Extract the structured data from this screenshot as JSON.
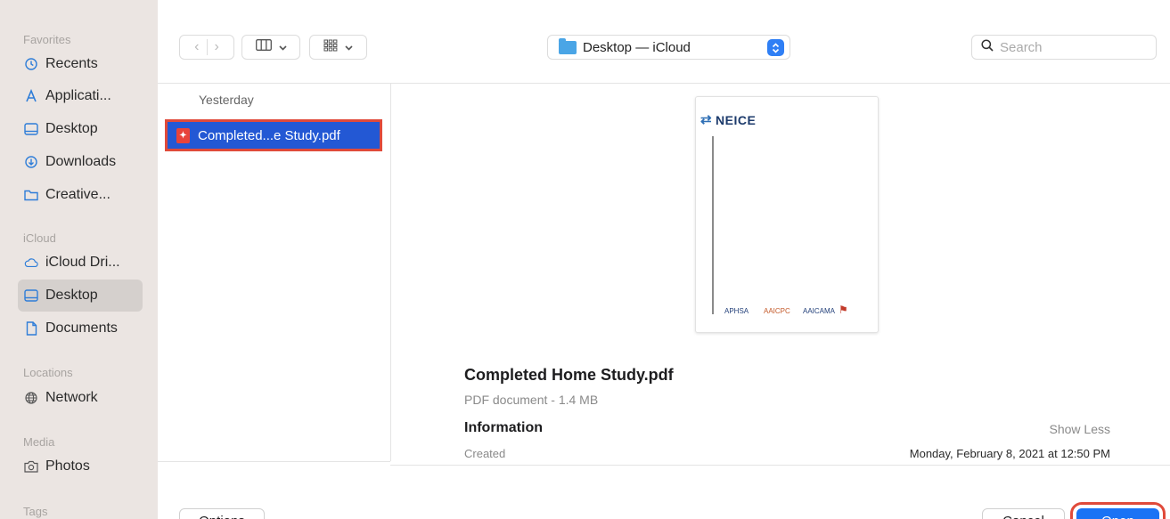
{
  "sidebar": {
    "favorites_label": "Favorites",
    "icloud_label": "iCloud",
    "locations_label": "Locations",
    "media_label": "Media",
    "tags_label": "Tags",
    "favorites": [
      {
        "label": "Recents",
        "icon": "clock-icon"
      },
      {
        "label": "Applicati...",
        "icon": "applications-icon"
      },
      {
        "label": "Desktop",
        "icon": "desktop-icon"
      },
      {
        "label": "Downloads",
        "icon": "downloads-icon"
      },
      {
        "label": "Creative...",
        "icon": "folder-icon"
      }
    ],
    "icloud": [
      {
        "label": "iCloud Dri...",
        "icon": "cloud-icon"
      },
      {
        "label": "Desktop",
        "icon": "desktop-icon",
        "active": true
      },
      {
        "label": "Documents",
        "icon": "document-icon"
      }
    ],
    "locations": [
      {
        "label": "Network",
        "icon": "globe-icon"
      }
    ],
    "media": [
      {
        "label": "Photos",
        "icon": "camera-icon"
      }
    ]
  },
  "toolbar": {
    "path_label": "Desktop — iCloud",
    "search_placeholder": "Search"
  },
  "browser": {
    "group_header": "Yesterday",
    "selected_file": "Completed...e Study.pdf"
  },
  "preview": {
    "thumb_logo": "NEICE",
    "thumb_footer": [
      "APHSA",
      "AAICPC",
      "AAICAMA"
    ],
    "file_name": "Completed Home Study.pdf",
    "file_kind": "PDF document - 1.4 MB",
    "info_heading": "Information",
    "show_less": "Show Less",
    "created_label": "Created",
    "created_value": "Monday, February 8, 2021 at 12:50 PM"
  },
  "buttons": {
    "options": "Options",
    "cancel": "Cancel",
    "open": "Open"
  },
  "colors": {
    "accent": "#1a73f5",
    "selection": "#2358d4",
    "highlight_outline": "#e04a3a"
  }
}
